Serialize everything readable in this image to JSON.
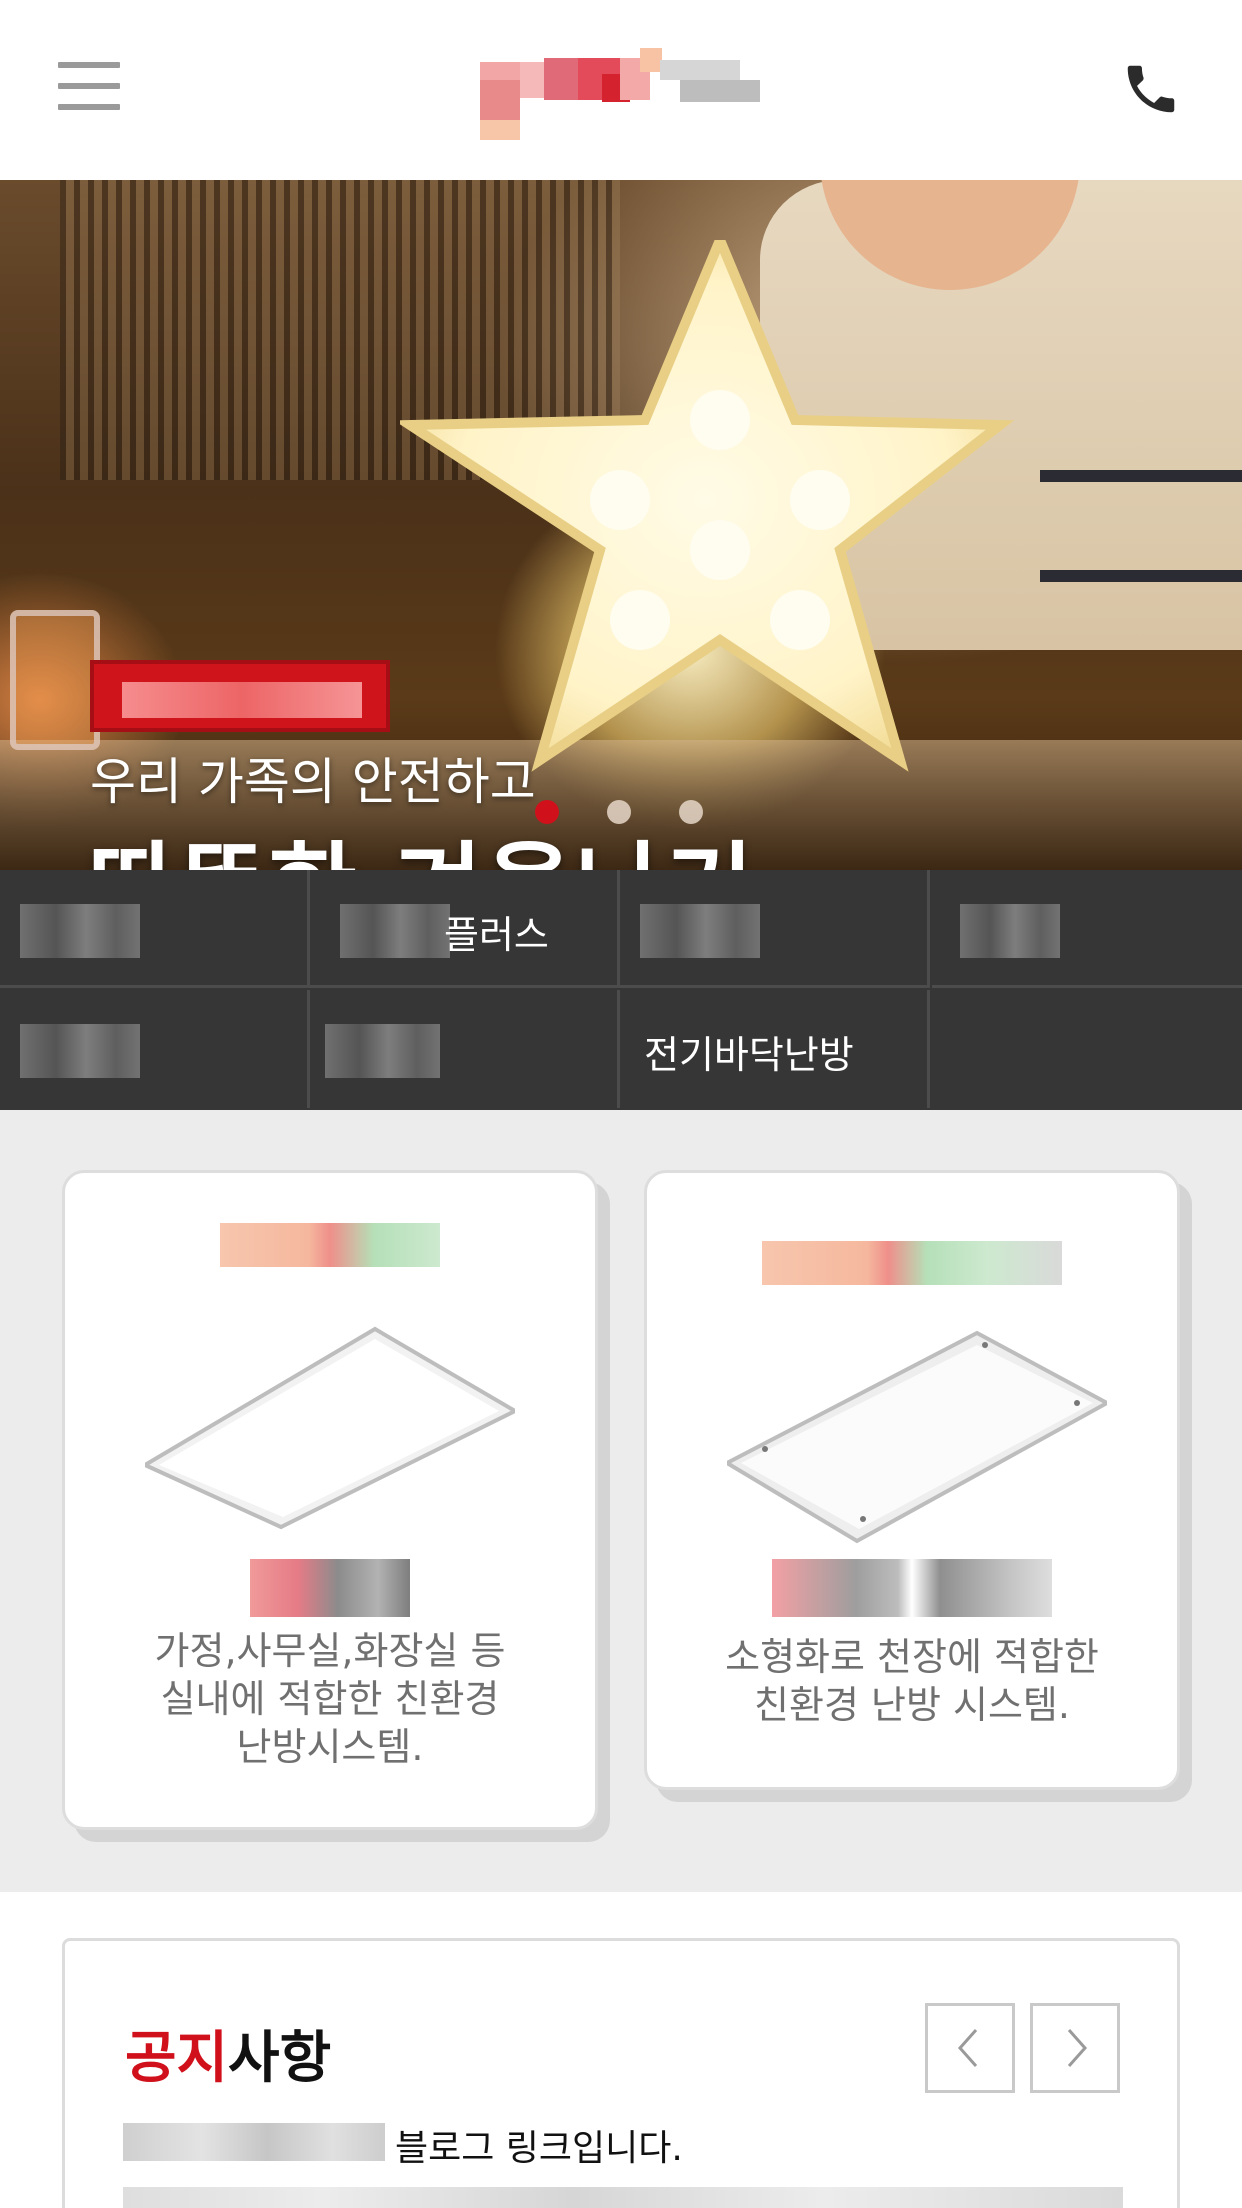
{
  "header": {
    "menu_icon": "hamburger-menu-icon",
    "logo": "brand-logo",
    "phone_icon": "phone-icon"
  },
  "hero": {
    "line1": "우리 가족의 안전하고",
    "line2": "따뜻한 겨울나기",
    "slides_total": 3,
    "active_slide": 1,
    "active_dot_color": "#d0111b"
  },
  "categories": [
    {
      "label": ""
    },
    {
      "label": "플러스"
    },
    {
      "label": ""
    },
    {
      "label": ""
    },
    {
      "label": ""
    },
    {
      "label": ""
    },
    {
      "label": "전기바닥난방"
    },
    {
      "label": ""
    }
  ],
  "products": [
    {
      "description": "가정,사무실,화장실 등\n실내에 적합한 친환경\n난방시스템."
    },
    {
      "description": "소형화로 천장에 적합한\n친환경 난방 시스템."
    }
  ],
  "notice": {
    "title_red": "공지",
    "title_black": "사항",
    "prev_icon": "chevron-left-icon",
    "next_icon": "chevron-right-icon",
    "items": [
      {
        "text": "블로그 링크입니다."
      }
    ]
  },
  "colors": {
    "accent": "#d0111b",
    "menu_bar": "#363636"
  }
}
